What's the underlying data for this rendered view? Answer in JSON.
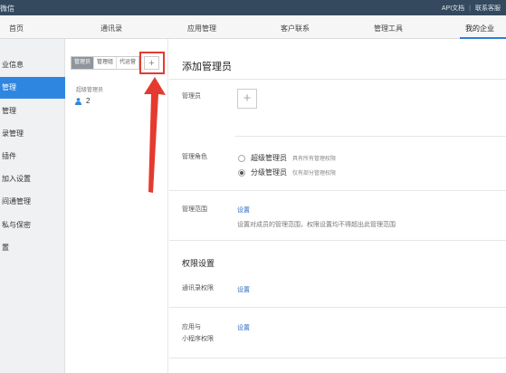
{
  "topbar": {
    "title": "微信",
    "link_api": "API文档",
    "link_support": "联系客服"
  },
  "nav": {
    "tabs": [
      "首页",
      "通讯录",
      "应用管理",
      "客户联系",
      "管理工具",
      "我的企业"
    ],
    "active_index": 5
  },
  "leftnav": {
    "items": [
      "业信息",
      "管理",
      "管理",
      "录管理",
      "插件",
      "加入设置",
      "间通管理",
      "私与保密",
      "置"
    ],
    "active_index": 1
  },
  "middle": {
    "segments": [
      "管理员",
      "管理组",
      "代运营"
    ],
    "active_segment": 0,
    "add_symbol": "+",
    "group_heading": "超级管理员",
    "admin_count": "2"
  },
  "main": {
    "title": "添加管理员",
    "admin_label": "管理员",
    "add_admin_symbol": "+",
    "role_label": "管理角色",
    "role_super": "超级管理员",
    "role_super_desc": "具有所有管理权限",
    "role_sub": "分级管理员",
    "role_sub_desc": "仅有部分管理权限",
    "selected_role": "role_sub",
    "scope_label": "管理范围",
    "scope_link": "设置",
    "scope_desc": "设置对成员的管理范围，权限设置均不得超出此管理范围",
    "perm_title": "权限设置",
    "contacts_perm_label": "通讯录权限",
    "contacts_perm_link": "设置",
    "app_perm_label_1": "应用与",
    "app_perm_label_2": "小程序权限",
    "app_perm_link": "设置"
  },
  "colors": {
    "topbar": "#34495e",
    "accent": "#2f86e0",
    "annotation_red": "#e53a2f",
    "link": "#2f6bbf"
  }
}
